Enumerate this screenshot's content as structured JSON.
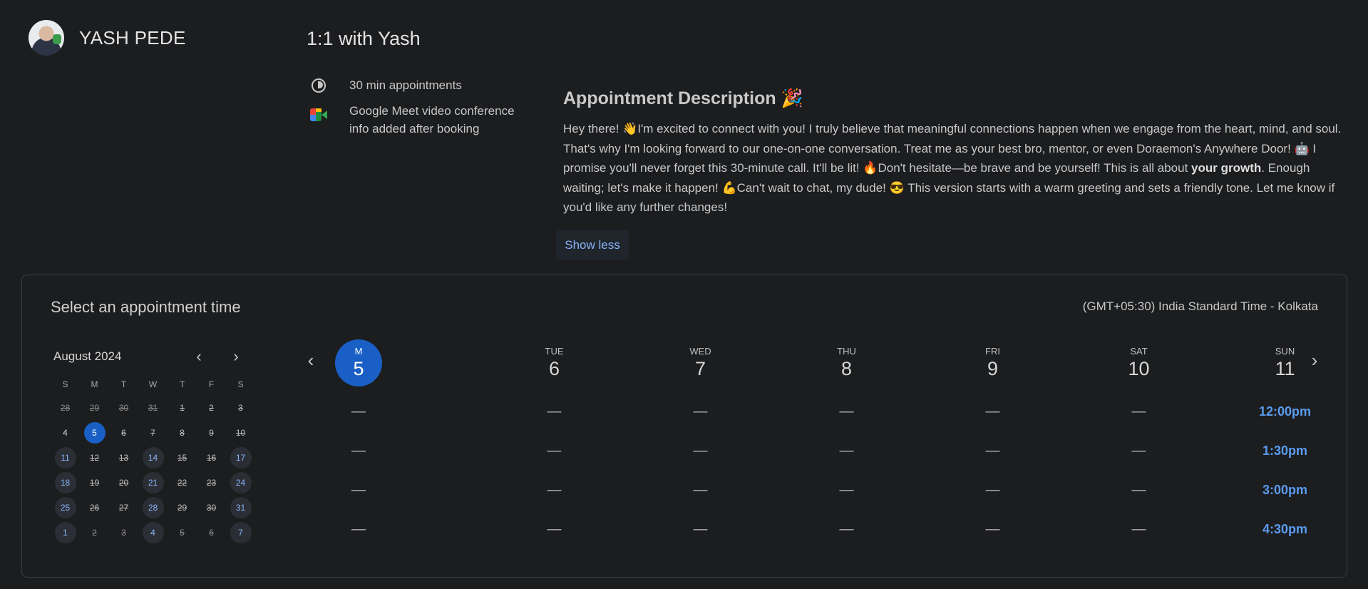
{
  "host": {
    "name": "YASH PEDE"
  },
  "event": {
    "title": "1:1 with Yash",
    "duration": "30 min appointments",
    "conference": "Google Meet video conference info added after booking"
  },
  "description": {
    "heading": "Appointment Description 🎉",
    "text_part1": "Hey there! 👋I'm excited to connect with you! I truly believe that meaningful connections happen when we engage from the heart, mind, and soul. That's why I'm looking forward to our one-on-one conversation. Treat me as your best bro, mentor, or even Doraemon's Anywhere Door! 🤖 I promise you'll never forget this 30-minute call. It'll be lit! 🔥Don't hesitate—be brave and be yourself! This is all about ",
    "text_bold": "your growth",
    "text_part2": ". Enough waiting; let's make it happen! 💪Can't wait to chat, my dude! 😎 This version starts with a warm greeting and sets a friendly tone. Let me know if you'd like any further changes!",
    "show_less": "Show less"
  },
  "scheduler": {
    "title": "Select an appointment time",
    "timezone": "(GMT+05:30) India Standard Time - Kolkata",
    "mini_calendar": {
      "month": "August 2024",
      "weekdays": [
        "S",
        "M",
        "T",
        "W",
        "T",
        "F",
        "S"
      ],
      "days": [
        {
          "d": "28",
          "s": "na dim"
        },
        {
          "d": "29",
          "s": "na dim"
        },
        {
          "d": "30",
          "s": "na dim"
        },
        {
          "d": "31",
          "s": "na dim"
        },
        {
          "d": "1",
          "s": "na"
        },
        {
          "d": "2",
          "s": "na"
        },
        {
          "d": "3",
          "s": "na"
        },
        {
          "d": "4",
          "s": "plain"
        },
        {
          "d": "5",
          "s": "sel"
        },
        {
          "d": "6",
          "s": "na"
        },
        {
          "d": "7",
          "s": "na"
        },
        {
          "d": "8",
          "s": "na"
        },
        {
          "d": "9",
          "s": "na"
        },
        {
          "d": "10",
          "s": "na"
        },
        {
          "d": "11",
          "s": "av"
        },
        {
          "d": "12",
          "s": "na"
        },
        {
          "d": "13",
          "s": "na"
        },
        {
          "d": "14",
          "s": "av"
        },
        {
          "d": "15",
          "s": "na"
        },
        {
          "d": "16",
          "s": "na"
        },
        {
          "d": "17",
          "s": "av"
        },
        {
          "d": "18",
          "s": "av"
        },
        {
          "d": "19",
          "s": "na"
        },
        {
          "d": "20",
          "s": "na"
        },
        {
          "d": "21",
          "s": "av"
        },
        {
          "d": "22",
          "s": "na"
        },
        {
          "d": "23",
          "s": "na"
        },
        {
          "d": "24",
          "s": "av"
        },
        {
          "d": "25",
          "s": "av"
        },
        {
          "d": "26",
          "s": "na"
        },
        {
          "d": "27",
          "s": "na"
        },
        {
          "d": "28",
          "s": "av"
        },
        {
          "d": "29",
          "s": "na"
        },
        {
          "d": "30",
          "s": "na"
        },
        {
          "d": "31",
          "s": "av"
        },
        {
          "d": "1",
          "s": "av"
        },
        {
          "d": "2",
          "s": "na dim"
        },
        {
          "d": "3",
          "s": "na dim"
        },
        {
          "d": "4",
          "s": "av"
        },
        {
          "d": "5",
          "s": "na dim"
        },
        {
          "d": "6",
          "s": "na dim"
        },
        {
          "d": "7",
          "s": "av"
        }
      ]
    },
    "week": [
      {
        "dow": "M",
        "date": "5",
        "active": true,
        "slots": [
          "—",
          "—",
          "—",
          "—"
        ]
      },
      {
        "dow": "TUE",
        "date": "6",
        "active": false,
        "slots": [
          "—",
          "—",
          "—",
          "—"
        ]
      },
      {
        "dow": "WED",
        "date": "7",
        "active": false,
        "slots": [
          "—",
          "—",
          "—",
          "—"
        ]
      },
      {
        "dow": "THU",
        "date": "8",
        "active": false,
        "slots": [
          "—",
          "—",
          "—",
          "—"
        ]
      },
      {
        "dow": "FRI",
        "date": "9",
        "active": false,
        "slots": [
          "—",
          "—",
          "—",
          "—"
        ]
      },
      {
        "dow": "SAT",
        "date": "10",
        "active": false,
        "slots": [
          "—",
          "—",
          "—",
          "—"
        ]
      },
      {
        "dow": "SUN",
        "date": "11",
        "active": false,
        "slots": [
          "12:00pm",
          "1:30pm",
          "3:00pm",
          "4:30pm"
        ]
      }
    ]
  },
  "icons": {
    "prev": "chevron-left-icon",
    "next": "chevron-right-icon",
    "duration": "clock-icon",
    "conference": "google-meet-icon"
  },
  "colors": {
    "background": "#1c1d1f",
    "accent": "#1a5fc6",
    "link": "#8ab4f8",
    "slot_time": "#5b9bf0"
  }
}
